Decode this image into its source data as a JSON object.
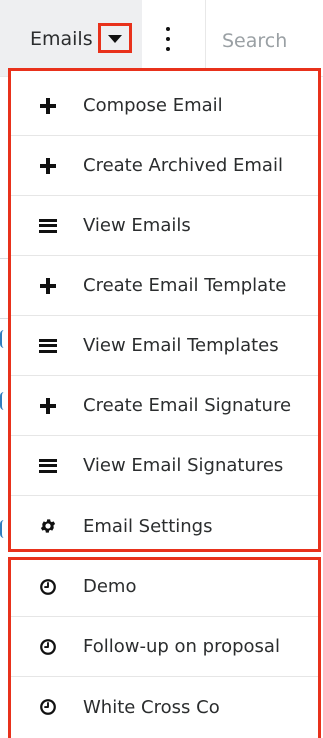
{
  "topbar": {
    "module_label": "Emails",
    "search_label": "Search"
  },
  "menu": {
    "items": [
      {
        "icon": "plus-icon",
        "label": "Compose Email"
      },
      {
        "icon": "plus-icon",
        "label": "Create Archived Email"
      },
      {
        "icon": "list-icon",
        "label": "View Emails"
      },
      {
        "icon": "plus-icon",
        "label": "Create Email Template"
      },
      {
        "icon": "list-icon",
        "label": "View Email Templates"
      },
      {
        "icon": "plus-icon",
        "label": "Create Email Signature"
      },
      {
        "icon": "list-icon",
        "label": "View Email Signatures"
      },
      {
        "icon": "gear-icon",
        "label": "Email Settings"
      }
    ]
  },
  "recents": {
    "items": [
      {
        "icon": "clock-icon",
        "label": "Demo"
      },
      {
        "icon": "clock-icon",
        "label": "Follow-up on proposal"
      },
      {
        "icon": "clock-icon",
        "label": "White Cross Co"
      }
    ]
  },
  "colors": {
    "highlight": "#e8311b",
    "tab_background": "#eeeff1",
    "text": "#2b2d2e",
    "placeholder": "#9aa0a4"
  }
}
